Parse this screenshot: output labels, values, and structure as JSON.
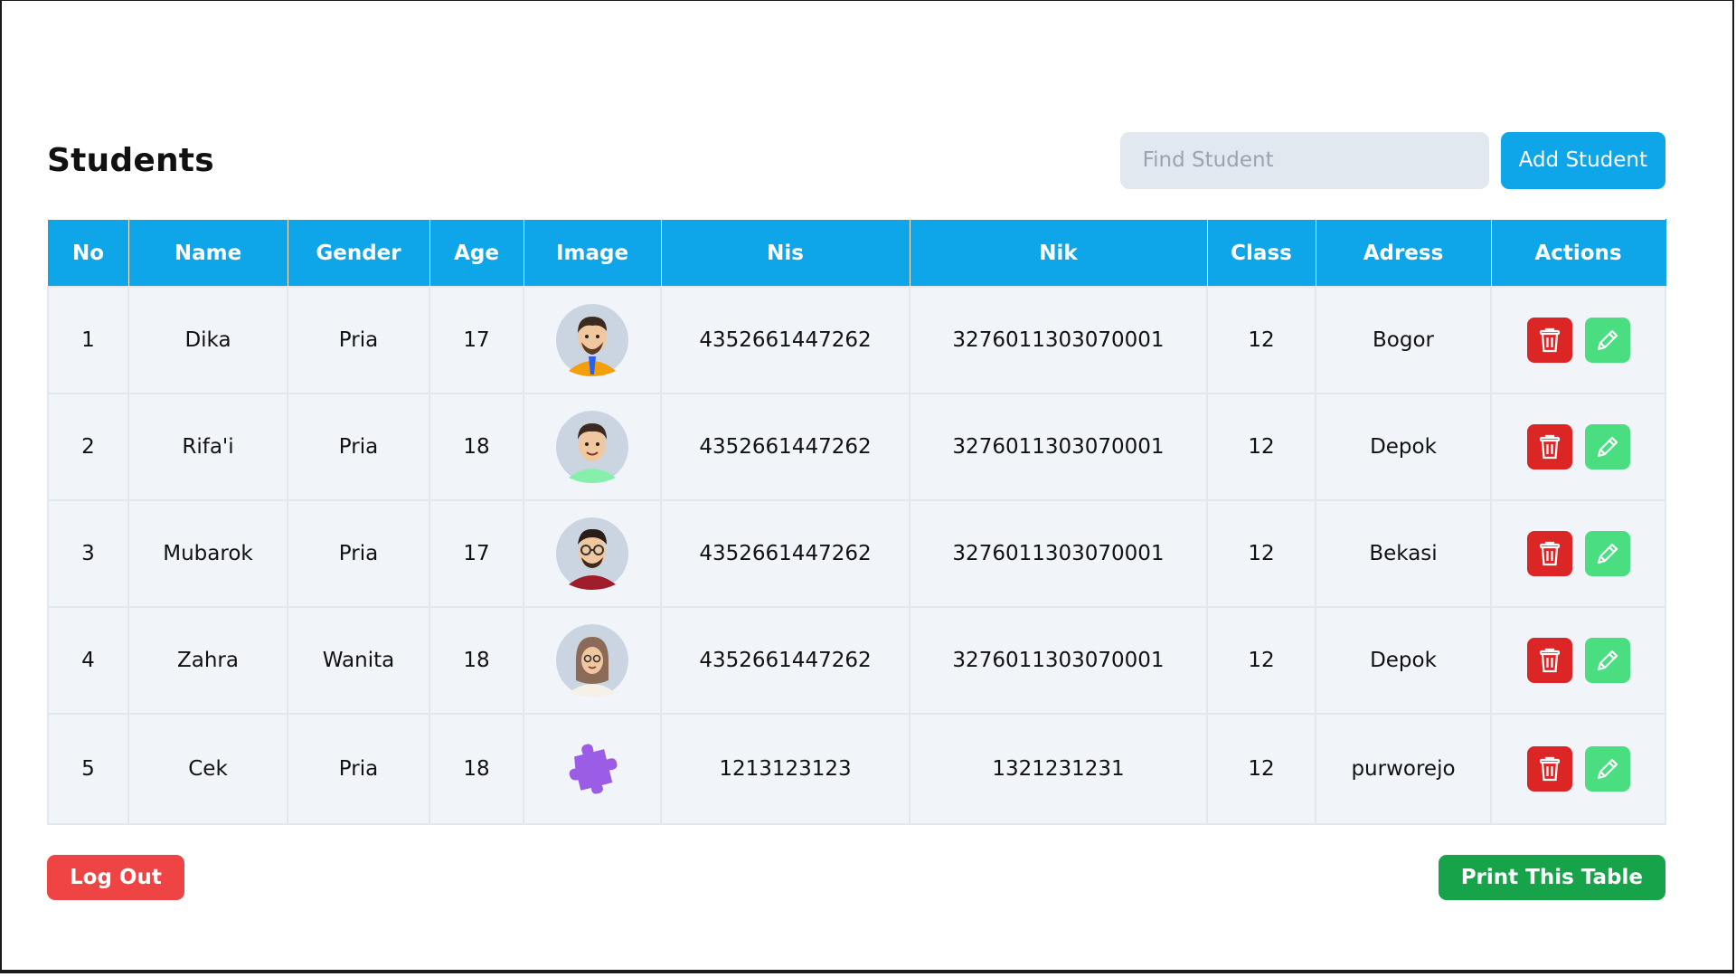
{
  "page": {
    "title": "Students"
  },
  "search": {
    "placeholder": "Find Student",
    "value": ""
  },
  "add_button_label": "Add Student",
  "table": {
    "headers": [
      "No",
      "Name",
      "Gender",
      "Age",
      "Image",
      "Nis",
      "Nik",
      "Class",
      "Adress",
      "Actions"
    ],
    "rows": [
      {
        "no": "1",
        "name": "Dika",
        "gender": "Pria",
        "age": "17",
        "image": "avatar-man-beard-icon",
        "nis": "4352661447262",
        "nik": "3276011303070001",
        "class": "12",
        "address": "Bogor"
      },
      {
        "no": "2",
        "name": "Rifa'i",
        "gender": "Pria",
        "age": "18",
        "image": "avatar-man-smile-icon",
        "nis": "4352661447262",
        "nik": "3276011303070001",
        "class": "12",
        "address": "Depok"
      },
      {
        "no": "3",
        "name": "Mubarok",
        "gender": "Pria",
        "age": "17",
        "image": "avatar-man-glasses-icon",
        "nis": "4352661447262",
        "nik": "3276011303070001",
        "class": "12",
        "address": "Bekasi"
      },
      {
        "no": "4",
        "name": "Zahra",
        "gender": "Wanita",
        "age": "18",
        "image": "avatar-woman-hijab-icon",
        "nis": "4352661447262",
        "nik": "3276011303070001",
        "class": "12",
        "address": "Depok"
      },
      {
        "no": "5",
        "name": "Cek",
        "gender": "Pria",
        "age": "18",
        "image": "puzzle-piece-icon",
        "nis": "1213123123",
        "nik": "1321231231",
        "class": "12",
        "address": "purworejo"
      }
    ],
    "actions": {
      "delete_icon": "trash-icon",
      "edit_icon": "pencil-icon"
    }
  },
  "footer": {
    "logout_label": "Log Out",
    "print_label": "Print This Table"
  },
  "colors": {
    "primary": "#0ea5e9",
    "danger": "#dc2626",
    "logout": "#ef4444",
    "edit": "#4ade80",
    "print": "#16a34a",
    "row_bg": "#f1f5f9",
    "search_bg": "#e2e8f0"
  }
}
